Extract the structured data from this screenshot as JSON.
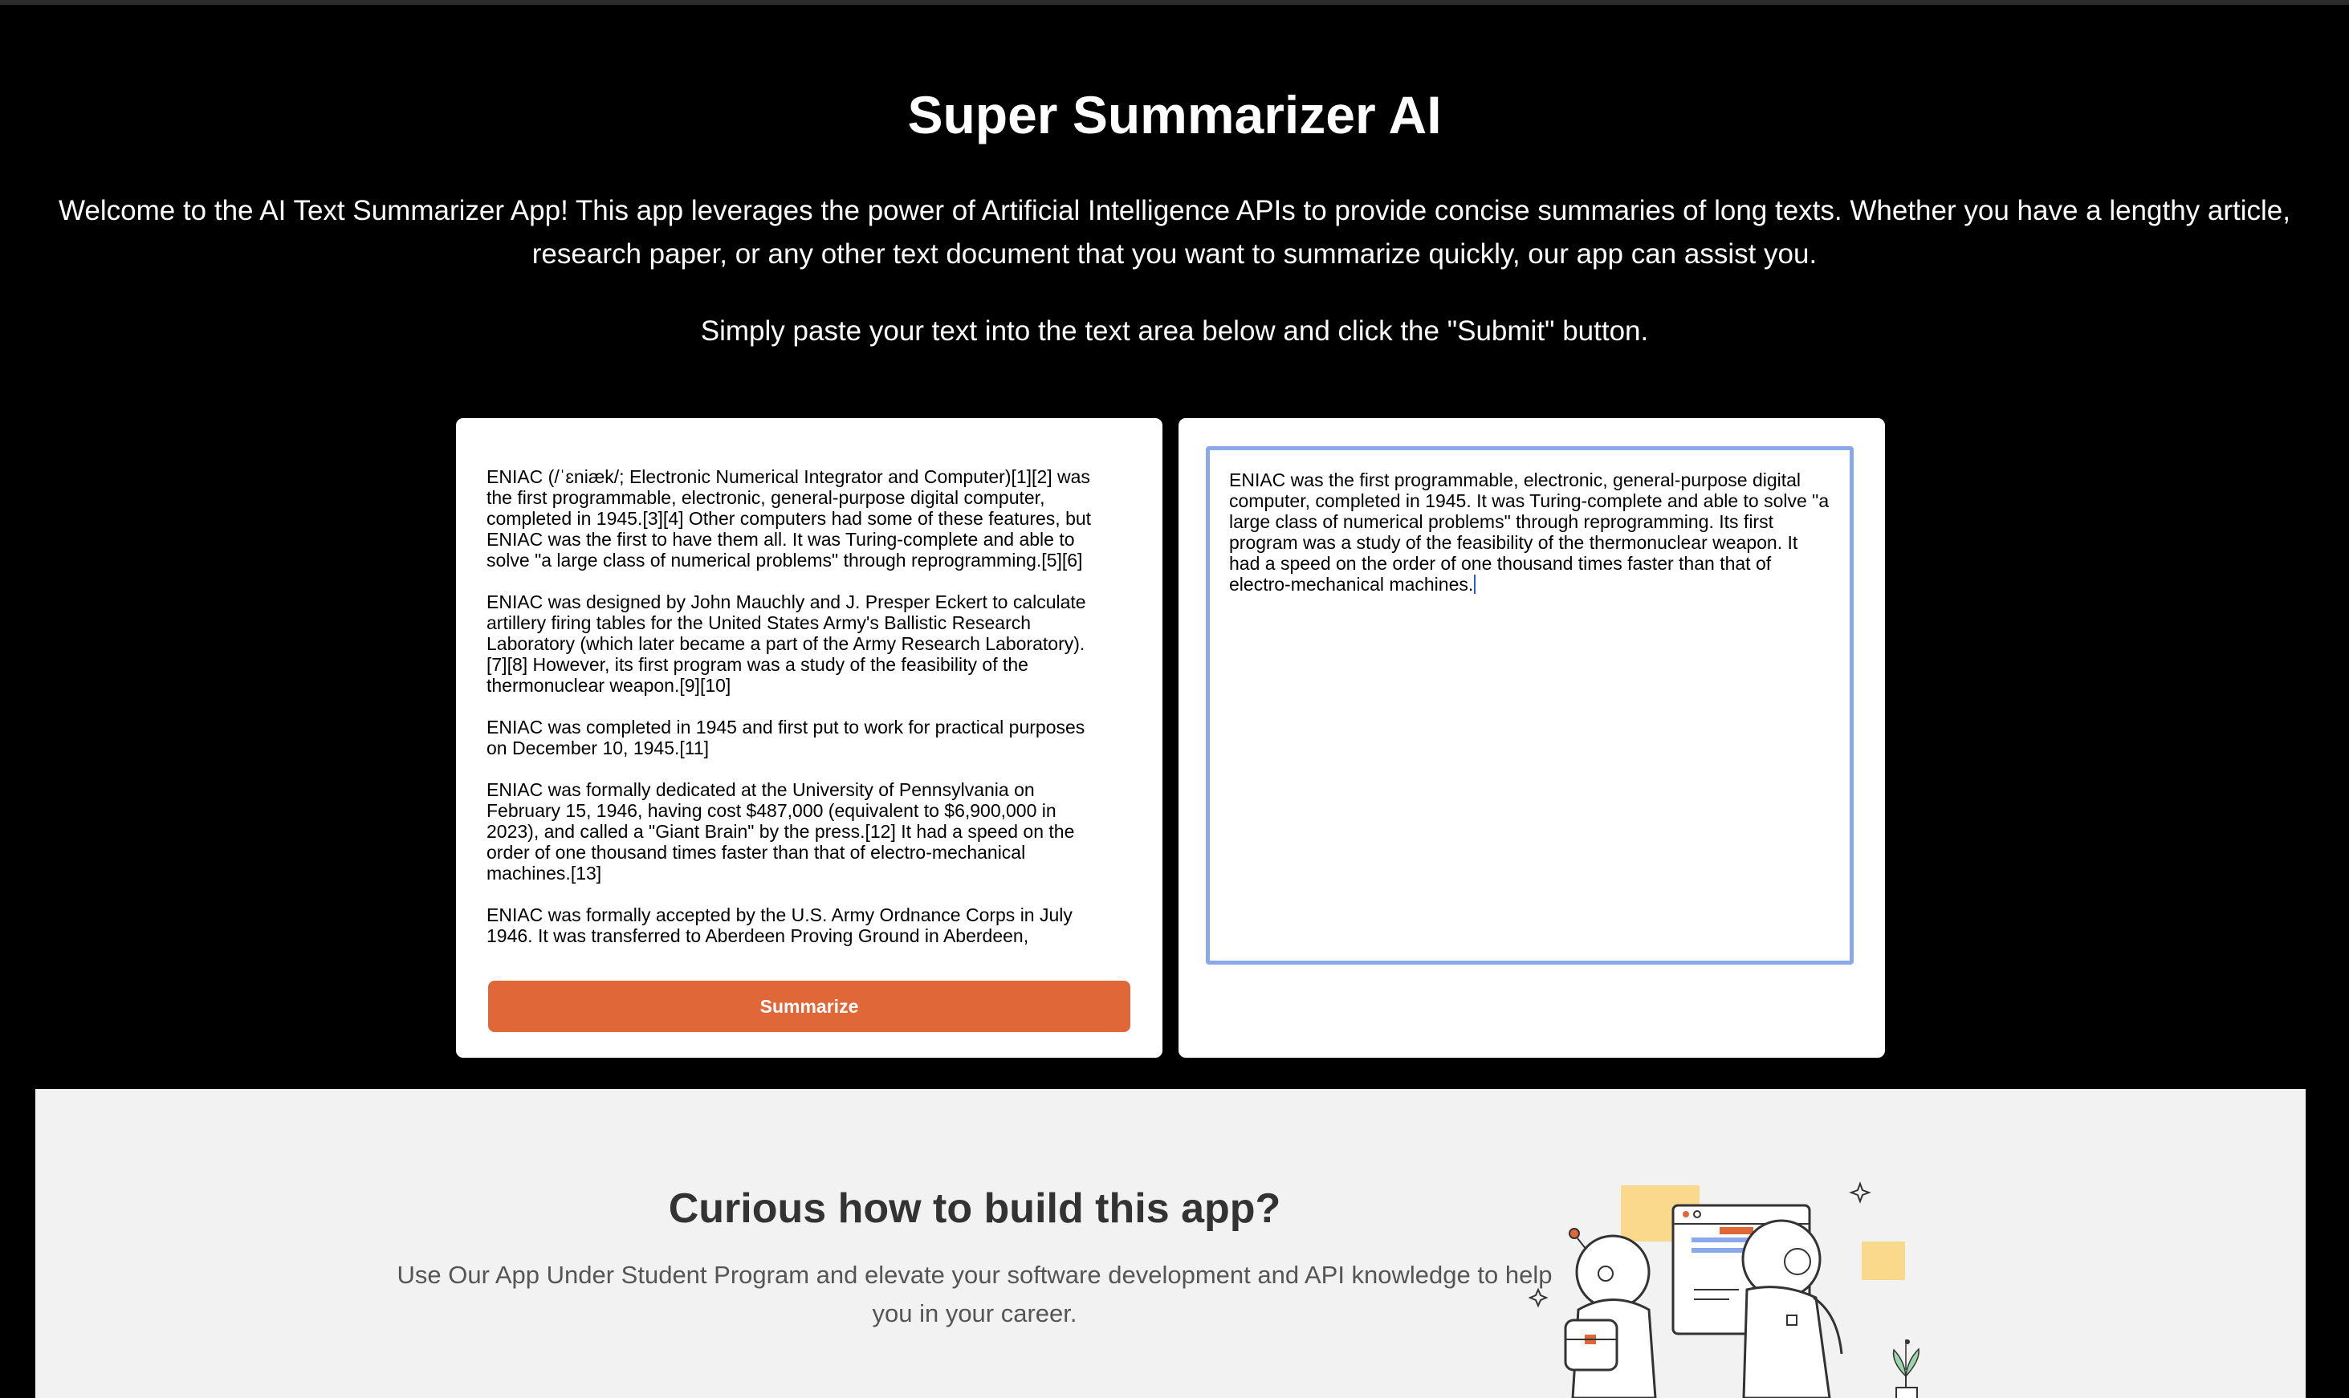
{
  "page": {
    "title": "Super Summarizer AI",
    "intro": "Welcome to the AI Text Summarizer App! This app leverages the power of Artificial Intelligence APIs to provide concise summaries of long texts. Whether you have a lengthy article, research paper, or any other text document that you want to summarize quickly, our app can assist you.",
    "instruction": "Simply paste your text into the text area below and click the \"Submit\" button."
  },
  "input": {
    "paragraphs": [
      "ENIAC (/ˈɛniæk/; Electronic Numerical Integrator and Computer)[1][2] was the first programmable, electronic, general-purpose digital computer, completed in 1945.[3][4] Other computers had some of these features, but ENIAC was the first to have them all. It was Turing-complete and able to solve \"a large class of numerical problems\" through reprogramming.[5][6]",
      "ENIAC was designed by John Mauchly and J. Presper Eckert to calculate artillery firing tables for the United States Army's Ballistic Research Laboratory (which later became a part of the Army Research Laboratory).[7][8] However, its first program was a study of the feasibility of the thermonuclear weapon.[9][10]",
      "ENIAC was completed in 1945 and first put to work for practical purposes on December 10, 1945.[11]",
      "ENIAC was formally dedicated at the University of Pennsylvania on February 15, 1946, having cost $487,000 (equivalent to $6,900,000 in 2023), and called a \"Giant Brain\" by the press.[12] It had a speed on the order of one thousand times faster than that of electro-mechanical machines.[13]",
      "ENIAC was formally accepted by the U.S. Army Ordnance Corps in July 1946. It was transferred to Aberdeen Proving Ground in Aberdeen,"
    ]
  },
  "summarize_button": "Summarize",
  "output": {
    "text": "ENIAC was the first programmable, electronic, general-purpose digital computer, completed in 1945. It was Turing-complete and able to solve \"a large class of numerical problems\" through reprogramming. Its first program was a study of the feasibility of the thermonuclear weapon. It had a speed on the order of one thousand times faster than that of electro-mechanical machines."
  },
  "promo": {
    "title": "Curious how to build this app?",
    "text": "Use Our App Under Student Program and elevate your software development and API knowledge to help you in your career."
  },
  "colors": {
    "background": "#000000",
    "accent": "#e06737",
    "focus_border": "#8aa9ea",
    "promo_background": "#f2f2f2"
  }
}
